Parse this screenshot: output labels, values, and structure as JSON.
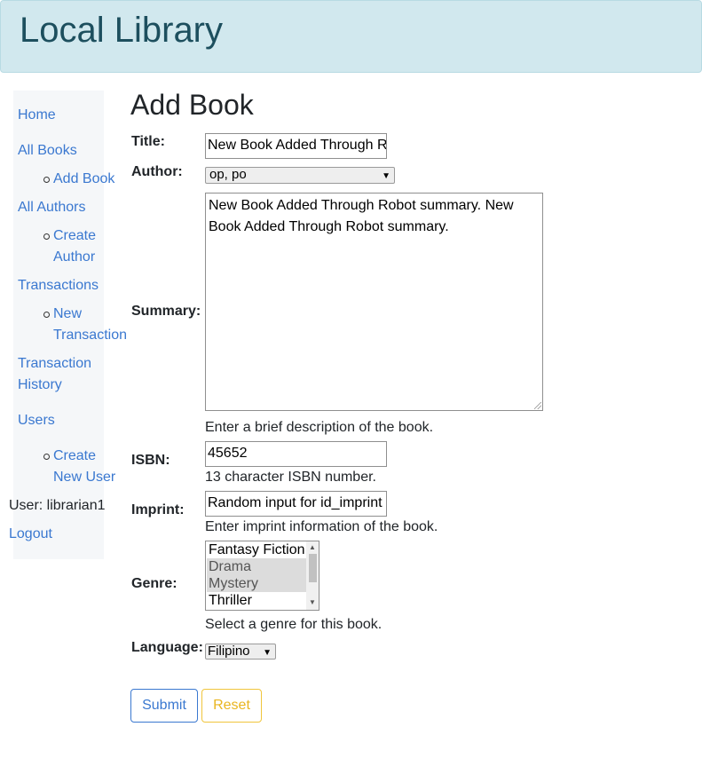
{
  "header": {
    "title": "Local Library"
  },
  "sidebar": {
    "home": "Home",
    "all_books": "All Books",
    "add_book": "Add Book",
    "all_authors": "All Authors",
    "create_author_1": "Create",
    "create_author_2": "Author",
    "transactions": "Transactions",
    "new_transaction_1": "New",
    "new_transaction_2": "Transaction",
    "transaction_history_1": "Transaction",
    "transaction_history_2": "History",
    "users": "Users",
    "create_user_1": "Create",
    "create_user_2": "New User",
    "user_label": "User: librarian1",
    "logout": "Logout"
  },
  "form": {
    "page_title": "Add Book",
    "title_label": "Title:",
    "title_value": "New Book Added Through Robot",
    "author_label": "Author:",
    "author_value": "op, po",
    "summary_label": "Summary:",
    "summary_value": "New Book Added Through Robot summary. New Book Added Through Robot summary.",
    "summary_help": "Enter a brief description of the book.",
    "isbn_label": "ISBN:",
    "isbn_value": "45652",
    "isbn_help": "13 character ISBN number.",
    "imprint_label": "Imprint:",
    "imprint_value": "Random input for id_imprint",
    "imprint_help": "Enter imprint information of the book.",
    "genre_label": "Genre:",
    "genre_options": [
      "Fantasy Fiction",
      "Drama",
      "Mystery",
      "Thriller"
    ],
    "genre_selected": [
      "Drama",
      "Mystery"
    ],
    "genre_help": "Select a genre for this book.",
    "language_label": "Language:",
    "language_value": "Filipino",
    "submit_label": "Submit",
    "reset_label": "Reset"
  },
  "colors": {
    "link": "#3a78d0",
    "header_bg": "#d1e8ee",
    "reset": "#e9b520"
  }
}
